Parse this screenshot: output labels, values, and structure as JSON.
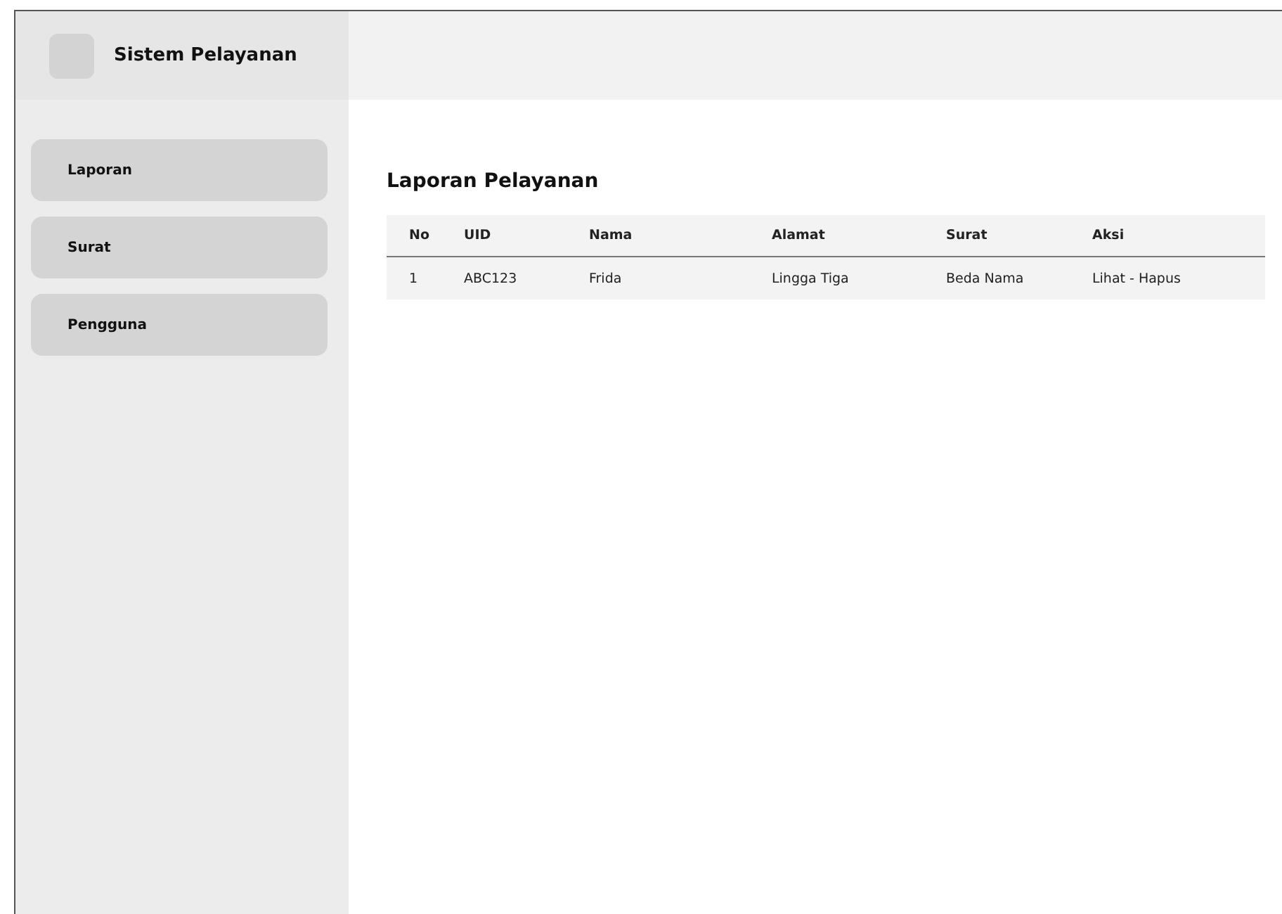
{
  "app": {
    "title": "Sistem Pelayanan"
  },
  "sidebar": {
    "items": [
      {
        "label": "Laporan"
      },
      {
        "label": "Surat"
      },
      {
        "label": "Pengguna"
      }
    ]
  },
  "page": {
    "title": "Laporan Pelayanan"
  },
  "table": {
    "columns": [
      "No",
      "UID",
      "Nama",
      "Alamat",
      "Surat",
      "Aksi"
    ],
    "rows": [
      [
        "1",
        "ABC123",
        "Frida",
        "Lingga Tiga",
        "Beda Nama",
        "Lihat - Hapus"
      ]
    ]
  }
}
